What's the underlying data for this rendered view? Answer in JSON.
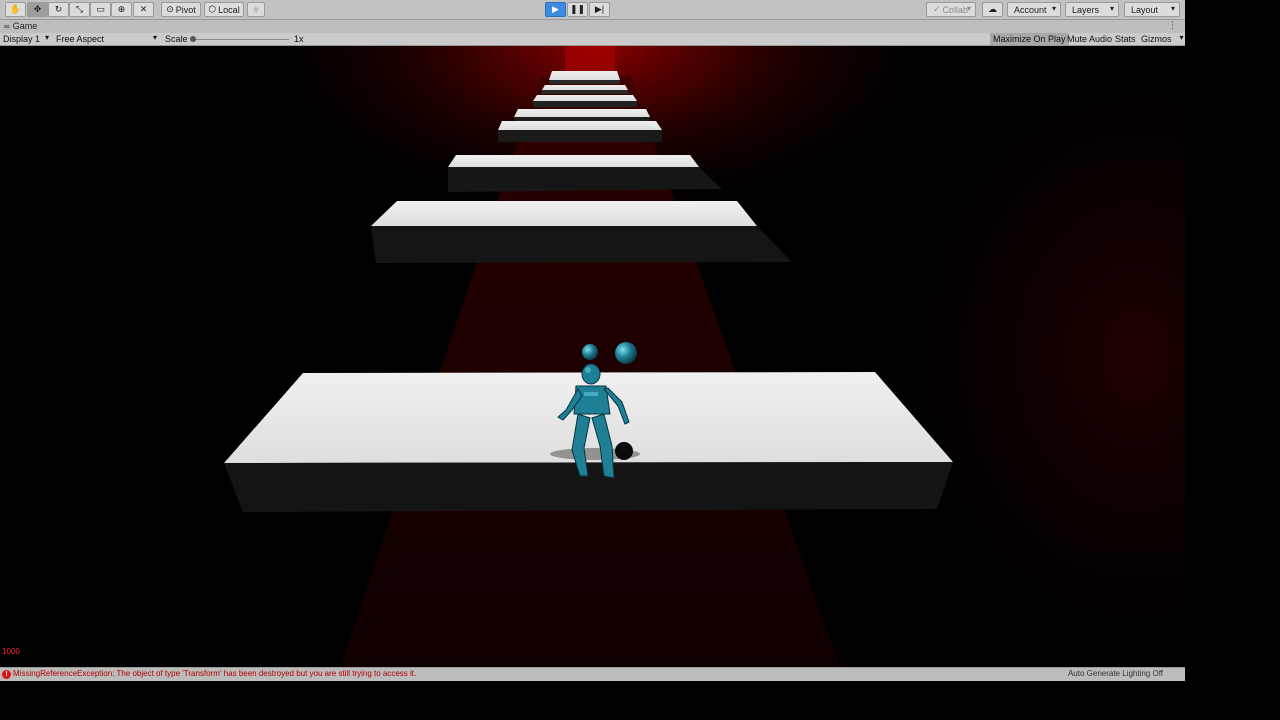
{
  "toolbar": {
    "tools": [
      "hand-tool",
      "move-tool",
      "rotate-tool",
      "scale-tool",
      "rect-tool",
      "transform-tool",
      "custom-tool"
    ],
    "pivot_label": "Pivot",
    "local_label": "Local",
    "collab_label": "Collab",
    "account_label": "Account",
    "layers_label": "Layers",
    "layout_label": "Layout"
  },
  "game_tab": {
    "title": "Game"
  },
  "game_toolbar": {
    "display": "Display 1",
    "aspect": "Free Aspect",
    "scale_label": "Scale",
    "scale_value": "1x",
    "maximize_label": "Maximize On Play",
    "mute_label": "Mute Audio",
    "stats_label": "Stats",
    "gizmos_label": "Gizmos"
  },
  "viewport": {
    "counter": "1000"
  },
  "statusbar": {
    "error_message": "MissingReferenceException: The object of type 'Transform' has been destroyed but you are still trying to access it.",
    "lighting_message": "Auto Generate Lighting Off"
  },
  "colors": {
    "play_active": "#3d8be0",
    "error_text": "#b60000",
    "counter_text": "#ff2b2b",
    "character": "#1f7f94"
  }
}
